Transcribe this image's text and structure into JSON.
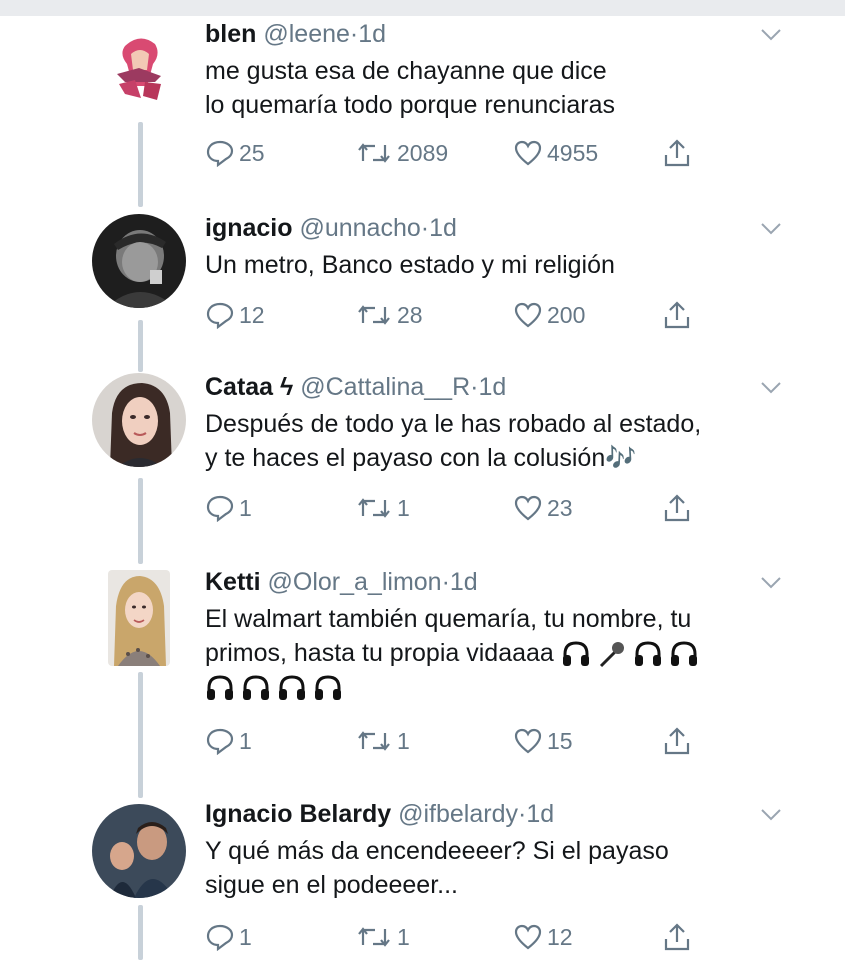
{
  "tweets": [
    {
      "name": "blen",
      "handle": "@leene",
      "time": "1d",
      "lines": [
        "me gusta esa de chayanne que dice",
        "lo quemaría todo porque renunciaras"
      ],
      "replies": "25",
      "retweets": "2089",
      "likes": "4955"
    },
    {
      "name": "ignacio",
      "handle": "@unnacho",
      "time": "1d",
      "lines": [
        "Un metro, Banco estado y mi religión"
      ],
      "replies": "12",
      "retweets": "28",
      "likes": "200"
    },
    {
      "name": "Cataa ϟ",
      "handle": "@Cattalina__R",
      "time": "1d",
      "lines": [
        "Después de todo ya le has robado al estado,",
        "y te haces el payaso con la colusión🎶"
      ],
      "replies": "1",
      "retweets": "1",
      "likes": "23"
    },
    {
      "name": "Ketti",
      "handle": "@Olor_a_limon",
      "time": "1d",
      "lines": [
        "El walmart también quemaría, tu nombre, tu",
        "primos, hasta tu propia vidaaaa"
      ],
      "emoji_line2": [
        "headphone-icon",
        "microphone-icon",
        "headphone-icon",
        "headphone-icon"
      ],
      "emoji_line3": [
        "headphone-icon",
        "headphone-icon",
        "headphone-icon",
        "headphone-icon"
      ],
      "replies": "1",
      "retweets": "1",
      "likes": "15"
    },
    {
      "name": "Ignacio Belardy",
      "handle": "@ifbelardy",
      "time": "1d",
      "lines": [
        "Y qué más da encendeeeer? Si el payaso",
        "sigue en el podeeeer..."
      ],
      "replies": "1",
      "retweets": "1",
      "likes": "12"
    }
  ],
  "separator": "·",
  "colors": {
    "text": "#14171a",
    "secondary": "#657786",
    "thread_line": "#c8d1d9"
  }
}
